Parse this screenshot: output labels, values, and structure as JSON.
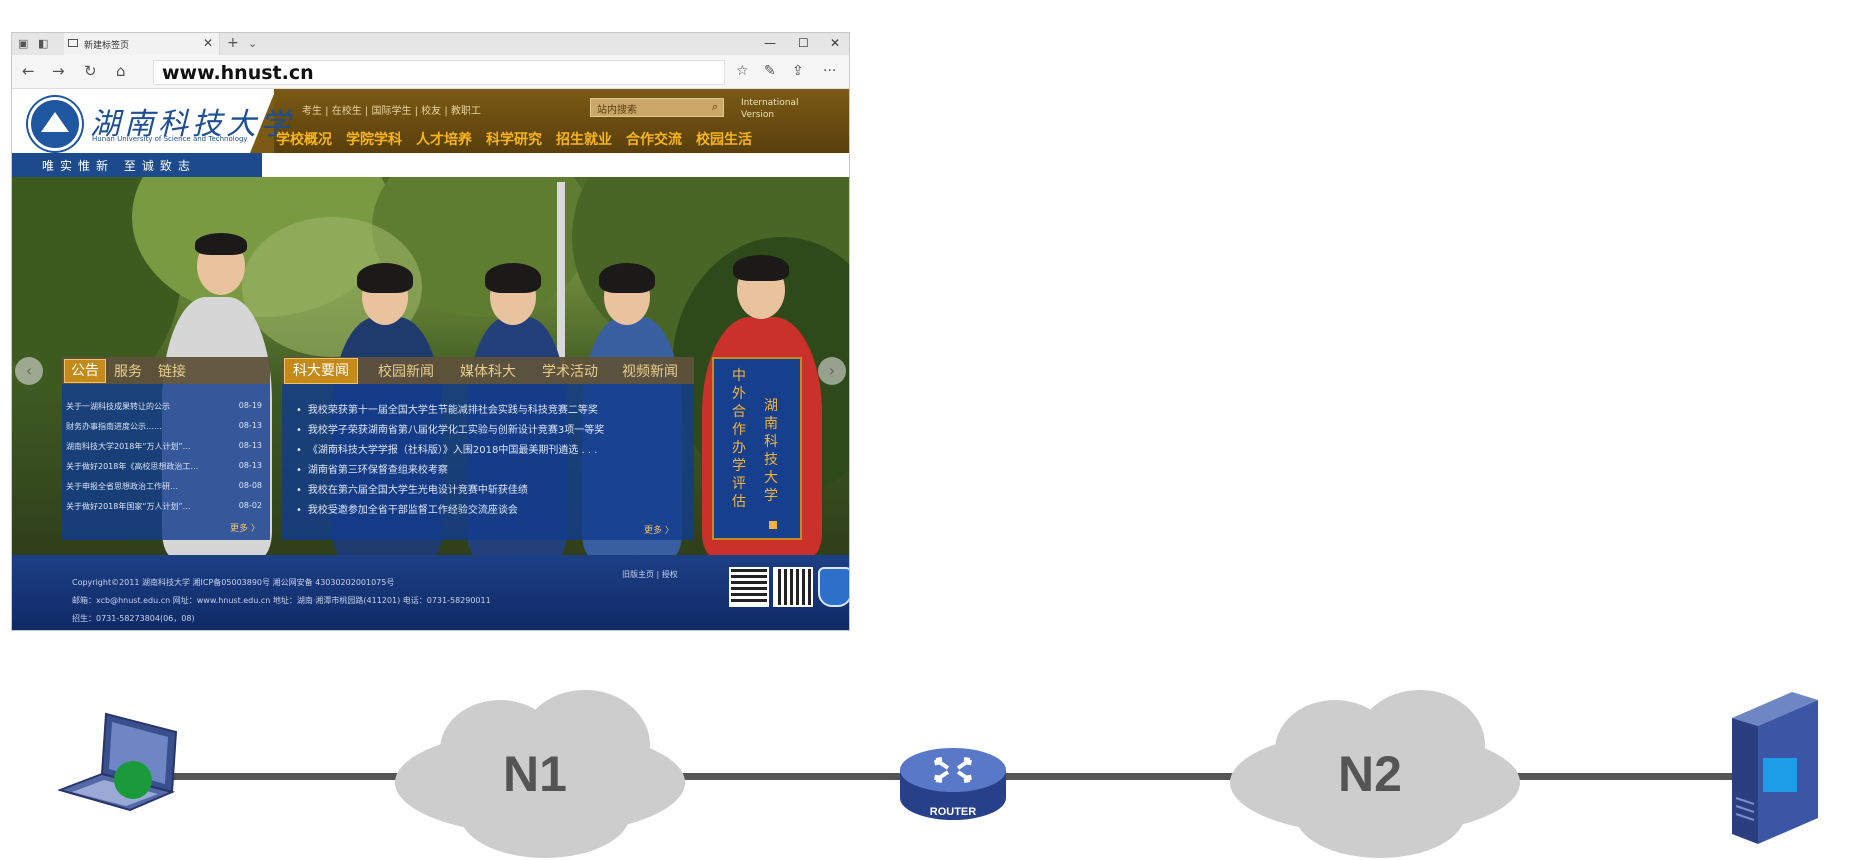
{
  "browser": {
    "tab_title": "新建标签页",
    "tab_close": "✕",
    "new_tab": "+",
    "tab_menu": "⌄",
    "minimize": "—",
    "maximize": "☐",
    "close": "✕",
    "back": "←",
    "forward": "→",
    "refresh": "↻",
    "home": "⌂",
    "address": "www.hnust.cn",
    "favorites": "☆",
    "pen": "✎",
    "share": "⇪",
    "more": "···"
  },
  "site": {
    "name": "湖南科技大学",
    "name_en": "Hunan University of Science and Technology",
    "motto": "唯实惟新  至诚致志",
    "top_links": "考生 | 在校生 | 国际学生 | 校友 | 教职工",
    "search_placeholder": "站内搜索",
    "search_icon": "⌕",
    "intl": "International Version",
    "nav": [
      "学校概况",
      "学院学科",
      "人才培养",
      "科学研究",
      "招生就业",
      "合作交流",
      "校园生活"
    ],
    "notice": {
      "tabs": [
        "公告",
        "服务",
        "链接"
      ],
      "items": [
        {
          "text": "关于一湖科技成果转让的公示",
          "date": "08-19"
        },
        {
          "text": "财务办事指南进度公示……",
          "date": "08-13"
        },
        {
          "text": "湖南科技大学2018年“万人计划”…",
          "date": "08-13"
        },
        {
          "text": "关于做好2018年《高校思想政治工…",
          "date": "08-13"
        },
        {
          "text": "关于申报全省思想政治工作研…",
          "date": "08-08"
        },
        {
          "text": "关于做好2018年国家“万人计划”…",
          "date": "08-02"
        }
      ],
      "more": "更多 〉"
    },
    "news": {
      "tabs": [
        "科大要闻",
        "校园新闻",
        "媒体科大",
        "学术活动",
        "视频新闻"
      ],
      "items": [
        "我校荣获第十一届全国大学生节能减排社会实践与科技竞赛二等奖",
        "我校学子荣获湖南省第八届化学化工实验与创新设计竞赛3项一等奖",
        "《湖南科技大学学报（社科版）》入围2018中国最美期刊遴选 . . .",
        "湖南省第三环保督查组来校考察",
        "我校在第六届全国大学生光电设计竞赛中斩获佳绩",
        "我校受邀参加全省干部监督工作经验交流座谈会"
      ],
      "more": "更多 〉"
    },
    "banner": {
      "col1": "湖南科技大学",
      "col2": "中外合作办学评估"
    },
    "footer": {
      "line1": "Copyright©2011 湖南科技大学  湘ICP备05003890号  湘公网安备 43030202001075号",
      "line2": "邮箱：xcb@hnust.edu.cn  网址：www.hnust.edu.cn  地址：湖南·湘潭市桃园路(411201)  电话：0731-58290011",
      "line3": "招生：0731-58273804(06，08)",
      "links": "旧版主页  |  授权"
    }
  },
  "diagram": {
    "cloud1": "N1",
    "cloud2": "N2",
    "router": "ROUTER"
  }
}
